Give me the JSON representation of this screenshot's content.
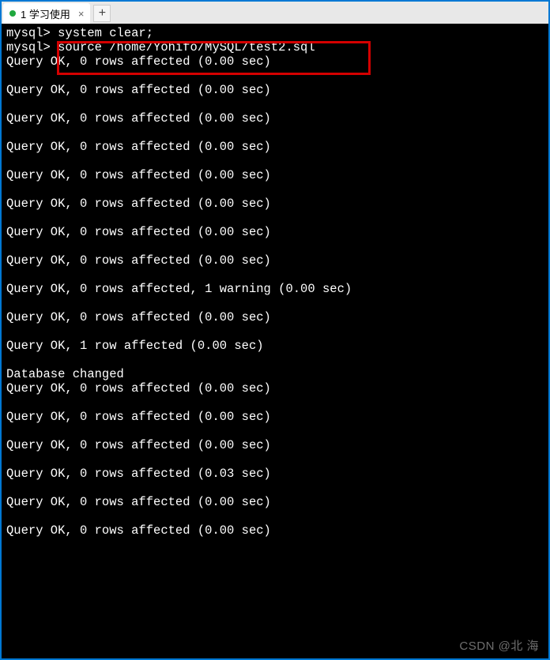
{
  "tabs": {
    "active": {
      "label": "1 学习使用"
    }
  },
  "terminal": {
    "lines": [
      "mysql> system clear;",
      "mysql> source /home/Yohifo/MySQL/test2.sql",
      "Query OK, 0 rows affected (0.00 sec)",
      "",
      "Query OK, 0 rows affected (0.00 sec)",
      "",
      "Query OK, 0 rows affected (0.00 sec)",
      "",
      "Query OK, 0 rows affected (0.00 sec)",
      "",
      "Query OK, 0 rows affected (0.00 sec)",
      "",
      "Query OK, 0 rows affected (0.00 sec)",
      "",
      "Query OK, 0 rows affected (0.00 sec)",
      "",
      "Query OK, 0 rows affected (0.00 sec)",
      "",
      "Query OK, 0 rows affected, 1 warning (0.00 sec)",
      "",
      "Query OK, 0 rows affected (0.00 sec)",
      "",
      "Query OK, 1 row affected (0.00 sec)",
      "",
      "Database changed",
      "Query OK, 0 rows affected (0.00 sec)",
      "",
      "Query OK, 0 rows affected (0.00 sec)",
      "",
      "Query OK, 0 rows affected (0.00 sec)",
      "",
      "Query OK, 0 rows affected (0.03 sec)",
      "",
      "Query OK, 0 rows affected (0.00 sec)",
      "",
      "Query OK, 0 rows affected (0.00 sec)",
      ""
    ]
  },
  "watermark": "CSDN @北  海"
}
